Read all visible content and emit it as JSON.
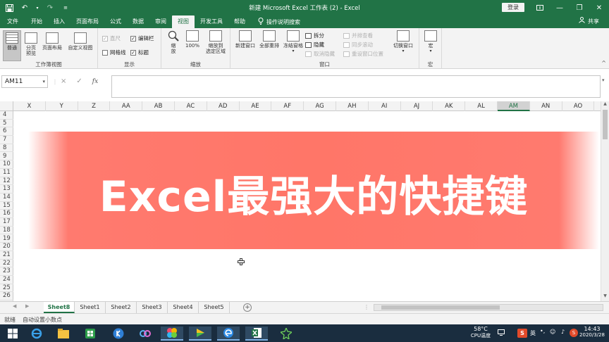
{
  "window": {
    "title": "新建 Microsoft Excel 工作表 (2)  -  Excel",
    "login": "登录"
  },
  "tabs": [
    "文件",
    "开始",
    "插入",
    "页面布局",
    "公式",
    "数据",
    "审阅",
    "视图",
    "开发工具",
    "帮助"
  ],
  "active_tab": "视图",
  "tell_me": "操作说明搜索",
  "share": "共享",
  "ribbon": {
    "groups": {
      "workbook_views": "工作簿视图",
      "show": "显示",
      "zoom": "缩放",
      "window": "窗口",
      "macros": "宏"
    },
    "workbook_views": {
      "normal": "普通",
      "page_break_1": "分页",
      "page_break_2": "预览",
      "page_layout": "页面布局",
      "custom_views": "自定义视图"
    },
    "show": {
      "ruler": "直尺",
      "formula_bar": "编辑栏",
      "gridlines": "网格线",
      "headings": "标题"
    },
    "zoom": {
      "zoom_1": "缩",
      "zoom_2": "放",
      "hundred": "100%",
      "to_selection_1": "缩放到",
      "to_selection_2": "选定区域"
    },
    "window": {
      "new_window": "新建窗口",
      "arrange_all": "全部重排",
      "freeze_panes": "冻结窗格",
      "split": "拆分",
      "hide": "隐藏",
      "unhide": "取消隐藏",
      "side_by_side": "并排查看",
      "sync_scroll": "同步滚动",
      "reset_position": "重设窗口位置",
      "switch_windows": "切换窗口"
    },
    "macros": {
      "macros": "宏"
    }
  },
  "formula_bar": {
    "name_box": "AM11",
    "cancel": "×",
    "enter": "✓",
    "fx": "fx"
  },
  "columns": [
    "X",
    "Y",
    "Z",
    "AA",
    "AB",
    "AC",
    "AD",
    "AE",
    "AF",
    "AG",
    "AH",
    "AI",
    "AJ",
    "AK",
    "AL",
    "AM",
    "AN",
    "AO"
  ],
  "selected_column": "AM",
  "rows": [
    "4",
    "5",
    "6",
    "7",
    "8",
    "9",
    "10",
    "11",
    "12",
    "13",
    "14",
    "15",
    "16",
    "17",
    "18",
    "19",
    "20",
    "21",
    "22",
    "23",
    "24",
    "25",
    "26"
  ],
  "banner_text": "Excel最强大的快捷键",
  "sheets": [
    "Sheet8",
    "Sheet1",
    "Sheet2",
    "Sheet3",
    "Sheet4",
    "Sheet5"
  ],
  "active_sheet": "Sheet8",
  "status": {
    "ready": "就绪",
    "auto_decimal": "自动设置小数点"
  },
  "taskbar": {
    "cpu_temp": "58°C",
    "cpu_label": "CPU温度",
    "time": "14:43",
    "date": "2020/3/28",
    "ime": "英"
  },
  "colors": {
    "excel_green": "#217346",
    "banner": "#ff7668",
    "taskbar": "#1a2d3f"
  }
}
